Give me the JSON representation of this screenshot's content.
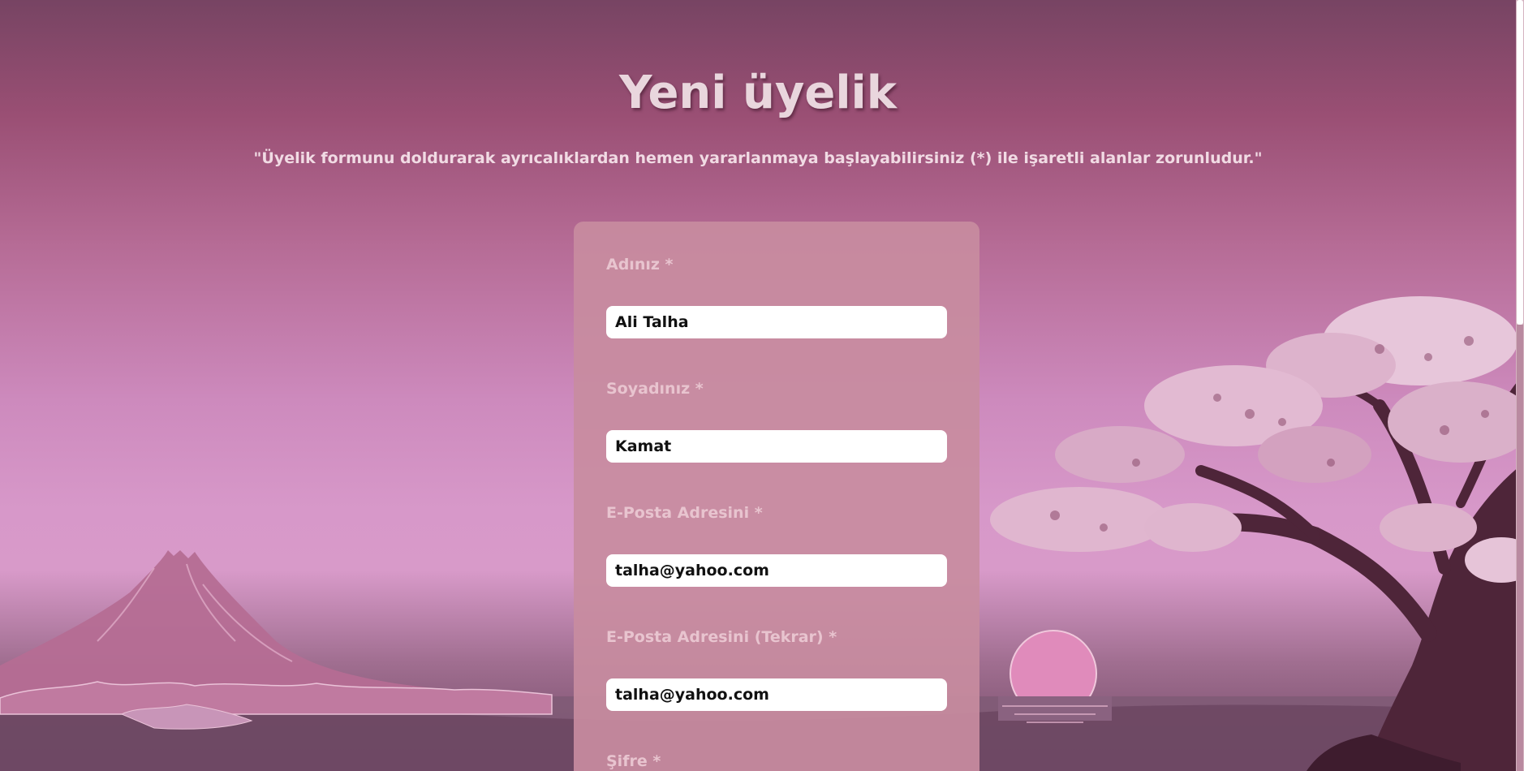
{
  "header": {
    "title": "Yeni üyelik",
    "subtitle": "\"Üyelik formunu doldurarak ayrıcalıklardan hemen yararlanmaya başlayabilirsiniz (*) ile işaretli alanlar zorunludur.\""
  },
  "form": {
    "fields": [
      {
        "label": "Adınız *",
        "value": "Ali Talha"
      },
      {
        "label": "Soyadınız *",
        "value": "Kamat"
      },
      {
        "label": "E-Posta Adresini *",
        "value": "talha@yahoo.com"
      },
      {
        "label": "E-Posta Adresini (Tekrar) *",
        "value": "talha@yahoo.com"
      },
      {
        "label": "Şifre *",
        "value": ""
      }
    ]
  },
  "background": {
    "icons": [
      "mountain-illustration",
      "cherry-blossom-tree-illustration",
      "setting-sun-illustration"
    ]
  },
  "colors": {
    "sky_top": "#774463",
    "sky_mid": "#d798c9",
    "card": "#c88ca0",
    "label": "#e8c4cf",
    "title": "#e9d6dd"
  }
}
